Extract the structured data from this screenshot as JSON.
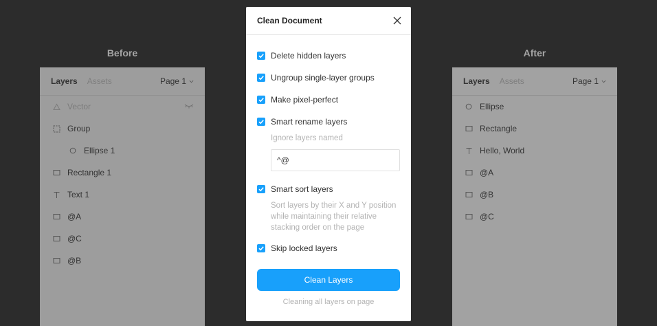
{
  "before": {
    "title": "Before",
    "tabs": {
      "layers": "Layers",
      "assets": "Assets"
    },
    "page": "Page 1",
    "layers": [
      {
        "name": "Vector",
        "icon": "vector-icon"
      },
      {
        "name": "Group",
        "icon": "frame-icon"
      },
      {
        "name": "Ellipse 1",
        "icon": "ellipse-icon"
      },
      {
        "name": "Rectangle 1",
        "icon": "rectangle-icon"
      },
      {
        "name": "Text 1",
        "icon": "text-icon"
      },
      {
        "name": "@A",
        "icon": "rectangle-icon"
      },
      {
        "name": "@C",
        "icon": "rectangle-icon"
      },
      {
        "name": "@B",
        "icon": "rectangle-icon"
      }
    ]
  },
  "after": {
    "title": "After",
    "tabs": {
      "layers": "Layers",
      "assets": "Assets"
    },
    "page": "Page 1",
    "layers": [
      {
        "name": "Ellipse",
        "icon": "ellipse-icon"
      },
      {
        "name": "Rectangle",
        "icon": "rectangle-icon"
      },
      {
        "name": "Hello, World",
        "icon": "text-icon"
      },
      {
        "name": "@A",
        "icon": "rectangle-icon"
      },
      {
        "name": "@B",
        "icon": "rectangle-icon"
      },
      {
        "name": "@C",
        "icon": "rectangle-icon"
      }
    ]
  },
  "dialog": {
    "title": "Clean Document",
    "options": {
      "delete_hidden": "Delete hidden layers",
      "ungroup": "Ungroup single-layer groups",
      "pixel_perfect": "Make pixel-perfect",
      "smart_rename": "Smart rename layers",
      "smart_sort": "Smart sort layers",
      "skip_locked": "Skip locked layers"
    },
    "ignore_label": "Ignore layers named",
    "ignore_value": "^@",
    "sort_description": "Sort layers by their X and Y position while maintaining their relative stacking order on the page",
    "button": "Clean Layers",
    "footer": "Cleaning all layers on page"
  },
  "colors": {
    "accent": "#18a0fb",
    "background": "#2c2c2c",
    "panel": "#9d9d9d"
  }
}
